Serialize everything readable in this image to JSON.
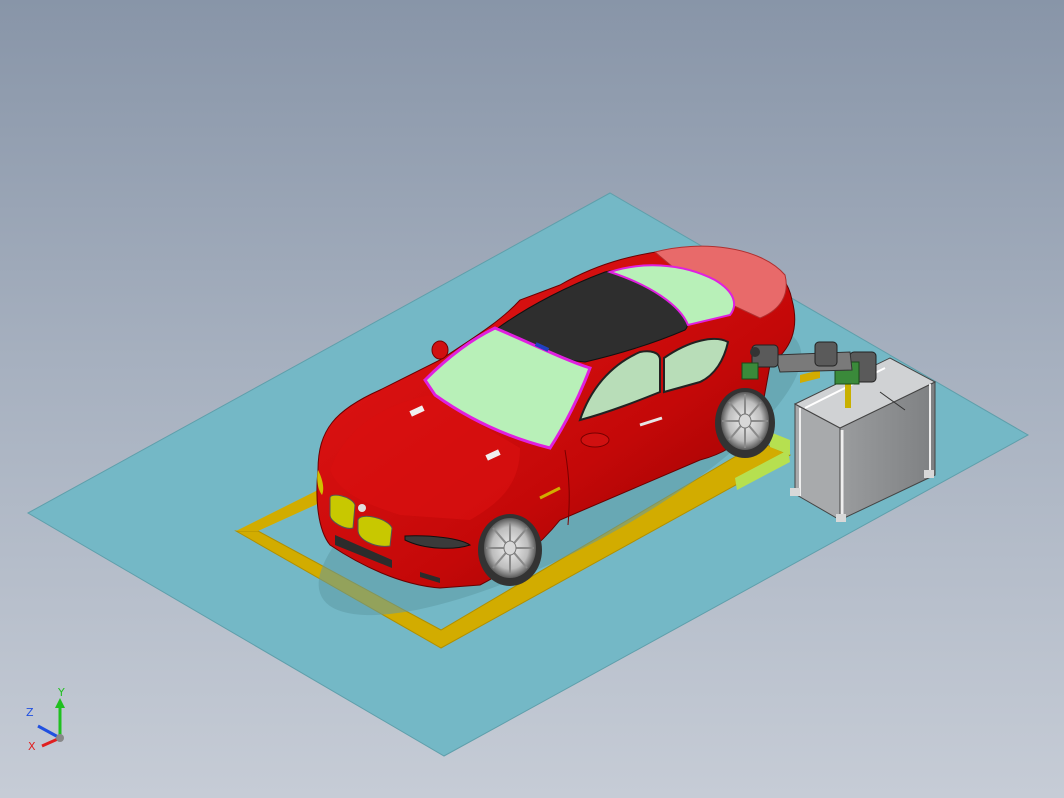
{
  "viewport": {
    "background_top": "#8895a8",
    "background_bottom": "#c6ccd6"
  },
  "scene": {
    "floor_color": "#74b8c6",
    "car_body_color": "#cc0a0a",
    "glass_color": "#b8f0b8",
    "roof_color": "#2e2e2e",
    "trim_color": "#e020e0",
    "safety_line_color": "#d9b000",
    "marker_color": "#b6e050",
    "cabinet_color": "#8a8c8e",
    "robot_color": "#5a5a5a",
    "camera_color": "#3a8a3a"
  },
  "triad": {
    "x_label": "X",
    "y_label": "Y",
    "z_label": "Z",
    "x_color": "#e02020",
    "y_color": "#20c020",
    "z_color": "#2050e0"
  }
}
